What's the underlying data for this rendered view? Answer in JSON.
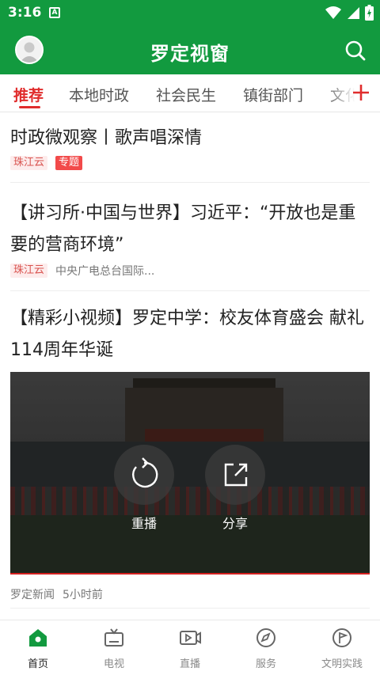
{
  "status_bar": {
    "time": "3:16",
    "notification_icon": "A"
  },
  "app_bar": {
    "title": "罗定视窗"
  },
  "tabs": [
    {
      "label": "推荐",
      "active": true
    },
    {
      "label": "本地时政",
      "active": false
    },
    {
      "label": "社会民生",
      "active": false
    },
    {
      "label": "镇街部门",
      "active": false
    },
    {
      "label": "文化",
      "active": false
    }
  ],
  "feed": {
    "items": [
      {
        "title": "时政微观察丨歌声唱深情",
        "source_tag": "珠江云",
        "topic_tag": "专题"
      },
      {
        "title": "【讲习所·中国与世界】习近平：“开放也是重要的营商环境”",
        "source_tag": "珠江云",
        "author": "中央广电总台国际..."
      },
      {
        "title": "【精彩小视频】罗定中学：校友体育盛会 献礼114周年华诞",
        "author": "罗定新闻",
        "time": "5小时前",
        "video": {
          "replay_label": "重播",
          "share_label": "分享"
        }
      }
    ]
  },
  "bottom_nav": [
    {
      "label": "首页",
      "icon": "home-icon",
      "active": true
    },
    {
      "label": "电视",
      "icon": "tv-icon",
      "active": false
    },
    {
      "label": "直播",
      "icon": "live-icon",
      "active": false
    },
    {
      "label": "服务",
      "icon": "compass-icon",
      "active": false
    },
    {
      "label": "文明实践",
      "icon": "flag-icon",
      "active": false
    }
  ],
  "colors": {
    "brand_green": "#129a3f",
    "accent_red": "#e02d2d",
    "tag_bg": "#fdecec"
  }
}
